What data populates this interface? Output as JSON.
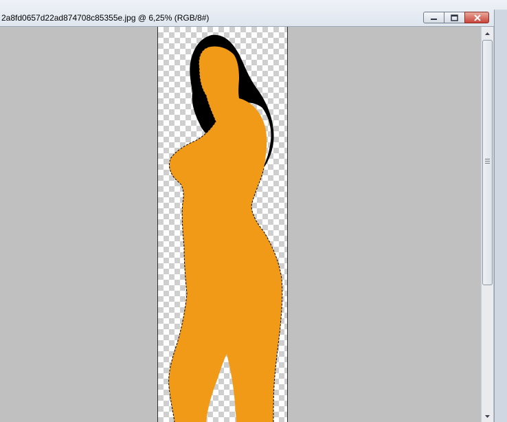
{
  "window": {
    "title": "2a8fd0657d22ad874708c85355e.jpg @ 6,25% (RGB/8#)"
  },
  "icons": {
    "minimize": "minimize-icon",
    "maximize": "restore-icon",
    "close": "close-icon",
    "scroll_up": "scroll-up-arrow-icon",
    "scroll_down": "scroll-down-arrow-icon",
    "scroll_grip": "scroll-grip-icon"
  },
  "colors": {
    "workspace": "#c0c0c0",
    "silhouette_fill": "#f19a18",
    "hair": "#000000",
    "close_button": "#c9443a"
  }
}
